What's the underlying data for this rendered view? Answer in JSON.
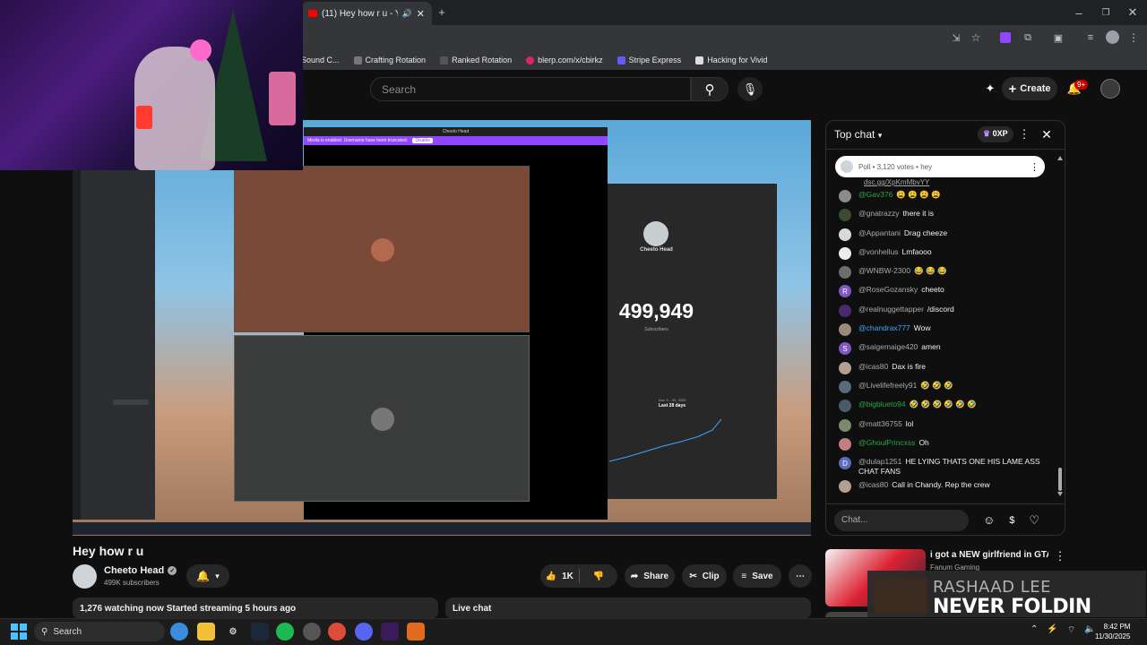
{
  "browser": {
    "tab_title": "(11) Hey how r u - YouTube",
    "bookmarks": [
      "Sound C...",
      "Crafting Rotation",
      "Ranked Rotation",
      "blerp.com/x/cbirkz",
      "Stripe Express",
      "Hacking for Vivid"
    ]
  },
  "yt_header": {
    "search_placeholder": "Search",
    "create_label": "Create",
    "notif_badge": "9+"
  },
  "stream": {
    "share_window_title": "Cheeto Head",
    "share_banner": "Media is enabled. Username have been truncated.",
    "share_banner_btn": "Disable",
    "studio_channel": "Cheeto Head",
    "studio_subscribers": "499,949",
    "studio_sub_label": "Subscribers",
    "studio_range_top": "Nov 3 – 30, 2025",
    "studio_range": "Last 28 days"
  },
  "video": {
    "title": "Hey how r u",
    "channel": "Cheeto Head",
    "subscribers": "499K subscribers",
    "likes": "1K",
    "share": "Share",
    "clip": "Clip",
    "save": "Save",
    "watching": "1,276 watching now  Started streaming 5 hours ago",
    "live_chat_bar": "Live chat"
  },
  "chat": {
    "mode": "Top chat",
    "xp": "0XP",
    "poll": "Poll • 3,120 votes • hey",
    "partial_top": "dsc.gg/XpKmMbvYY",
    "messages": [
      {
        "user": "@Gav376",
        "text": "😩 😩 😩 😩",
        "style": "member",
        "color": "#8a8a8a",
        "initial": ""
      },
      {
        "user": "@gnatrazzy",
        "text": "there it is",
        "style": "",
        "color": "#3c4a33",
        "initial": ""
      },
      {
        "user": "@Appantani",
        "text": "Drag cheeze",
        "style": "",
        "color": "#d9d9d9",
        "initial": ""
      },
      {
        "user": "@vonhellus",
        "text": "Lmfaooo",
        "style": "",
        "color": "#ededed",
        "initial": ""
      },
      {
        "user": "@WNBW-2300",
        "text": "😂 😂 😂",
        "style": "",
        "color": "#6d6d6d",
        "initial": ""
      },
      {
        "user": "@RoseGozansky",
        "text": "cheeto",
        "style": "",
        "color": "#7e57c2",
        "initial": "R"
      },
      {
        "user": "@realnuggettapper",
        "text": "/discord",
        "style": "",
        "color": "#4a2a6e",
        "initial": ""
      },
      {
        "user": "@chandrax777",
        "text": "Wow",
        "style": "blue",
        "color": "#9b8a7a",
        "initial": ""
      },
      {
        "user": "@saigemaige420",
        "text": "amen",
        "style": "",
        "color": "#7e57c2",
        "initial": "S"
      },
      {
        "user": "@icas80",
        "text": "Dax is fire",
        "style": "",
        "color": "#b0a090",
        "initial": ""
      },
      {
        "user": "@Livelifefreely91",
        "text": "🤣 🤣 🤣",
        "style": "",
        "color": "#5a6b7c",
        "initial": ""
      },
      {
        "user": "@bigblueto94",
        "text": "🤣 🤣 🤣 🤣 🤣 🤣",
        "style": "member",
        "color": "#4a5a6a",
        "initial": ""
      },
      {
        "user": "@matt36755",
        "text": "lol",
        "style": "",
        "color": "#7a8a6a",
        "initial": ""
      },
      {
        "user": "@GhoulPrincxss",
        "text": "Oh",
        "style": "member",
        "color": "#c08080",
        "initial": ""
      },
      {
        "user": "@dulap1251",
        "text": "HE LYING THATS ONE HIS LAME ASS CHAT FANS",
        "style": "",
        "color": "#5c6bc0",
        "initial": "D"
      },
      {
        "user": "@icas80",
        "text": "Call in Chandy. Rep the crew",
        "style": "",
        "color": "#b0a090",
        "initial": ""
      }
    ],
    "input_placeholder": "Chat..."
  },
  "recommended": {
    "title": "i got a NEW girlfriend in GTA...",
    "channel": "Fanum Gaming"
  },
  "now_playing": {
    "artist": "RASHAAD LEE",
    "song": "NEVER FOLDIN"
  },
  "taskbar": {
    "search": "Search",
    "time": "8:42 PM",
    "date": "11/30/2025"
  },
  "colors": {
    "accent_red": "#cc0000",
    "discord_purple": "#9146ff",
    "member_green": "#2ba640"
  }
}
